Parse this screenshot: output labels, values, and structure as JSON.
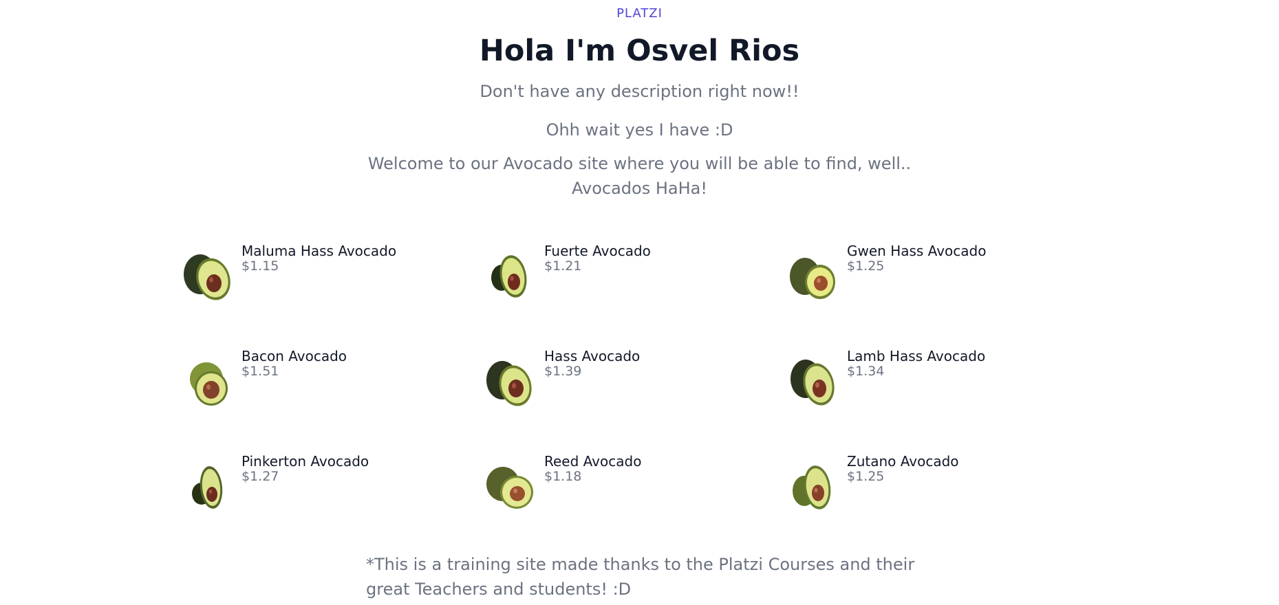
{
  "header": {
    "brand": "PLATZI",
    "title": "Hola I'm Osvel Rios",
    "subtitle": "Don't have any description right now!!",
    "subtitle_2": "Ohh wait yes I have :D",
    "welcome": "Welcome to our Avocado site where you will be able to find, well.. Avocados HaHa!"
  },
  "products": [
    {
      "name": "Maluma Hass Avocado",
      "price": "$1.15"
    },
    {
      "name": "Fuerte Avocado",
      "price": "$1.21"
    },
    {
      "name": "Gwen Hass Avocado",
      "price": "$1.25"
    },
    {
      "name": "Bacon Avocado",
      "price": "$1.51"
    },
    {
      "name": "Hass Avocado",
      "price": "$1.39"
    },
    {
      "name": "Lamb Hass Avocado",
      "price": "$1.34"
    },
    {
      "name": "Pinkerton Avocado",
      "price": "$1.27"
    },
    {
      "name": "Reed Avocado",
      "price": "$1.18"
    },
    {
      "name": "Zutano Avocado",
      "price": "$1.25"
    }
  ],
  "footer": {
    "note": "*This is a training site made thanks to the Platzi Courses and their great Teachers and students! :D"
  },
  "colors": {
    "brand": "#5046d6",
    "title": "#111827",
    "muted": "#6b7280"
  },
  "icons": {
    "product_image": "avocado-icon"
  }
}
